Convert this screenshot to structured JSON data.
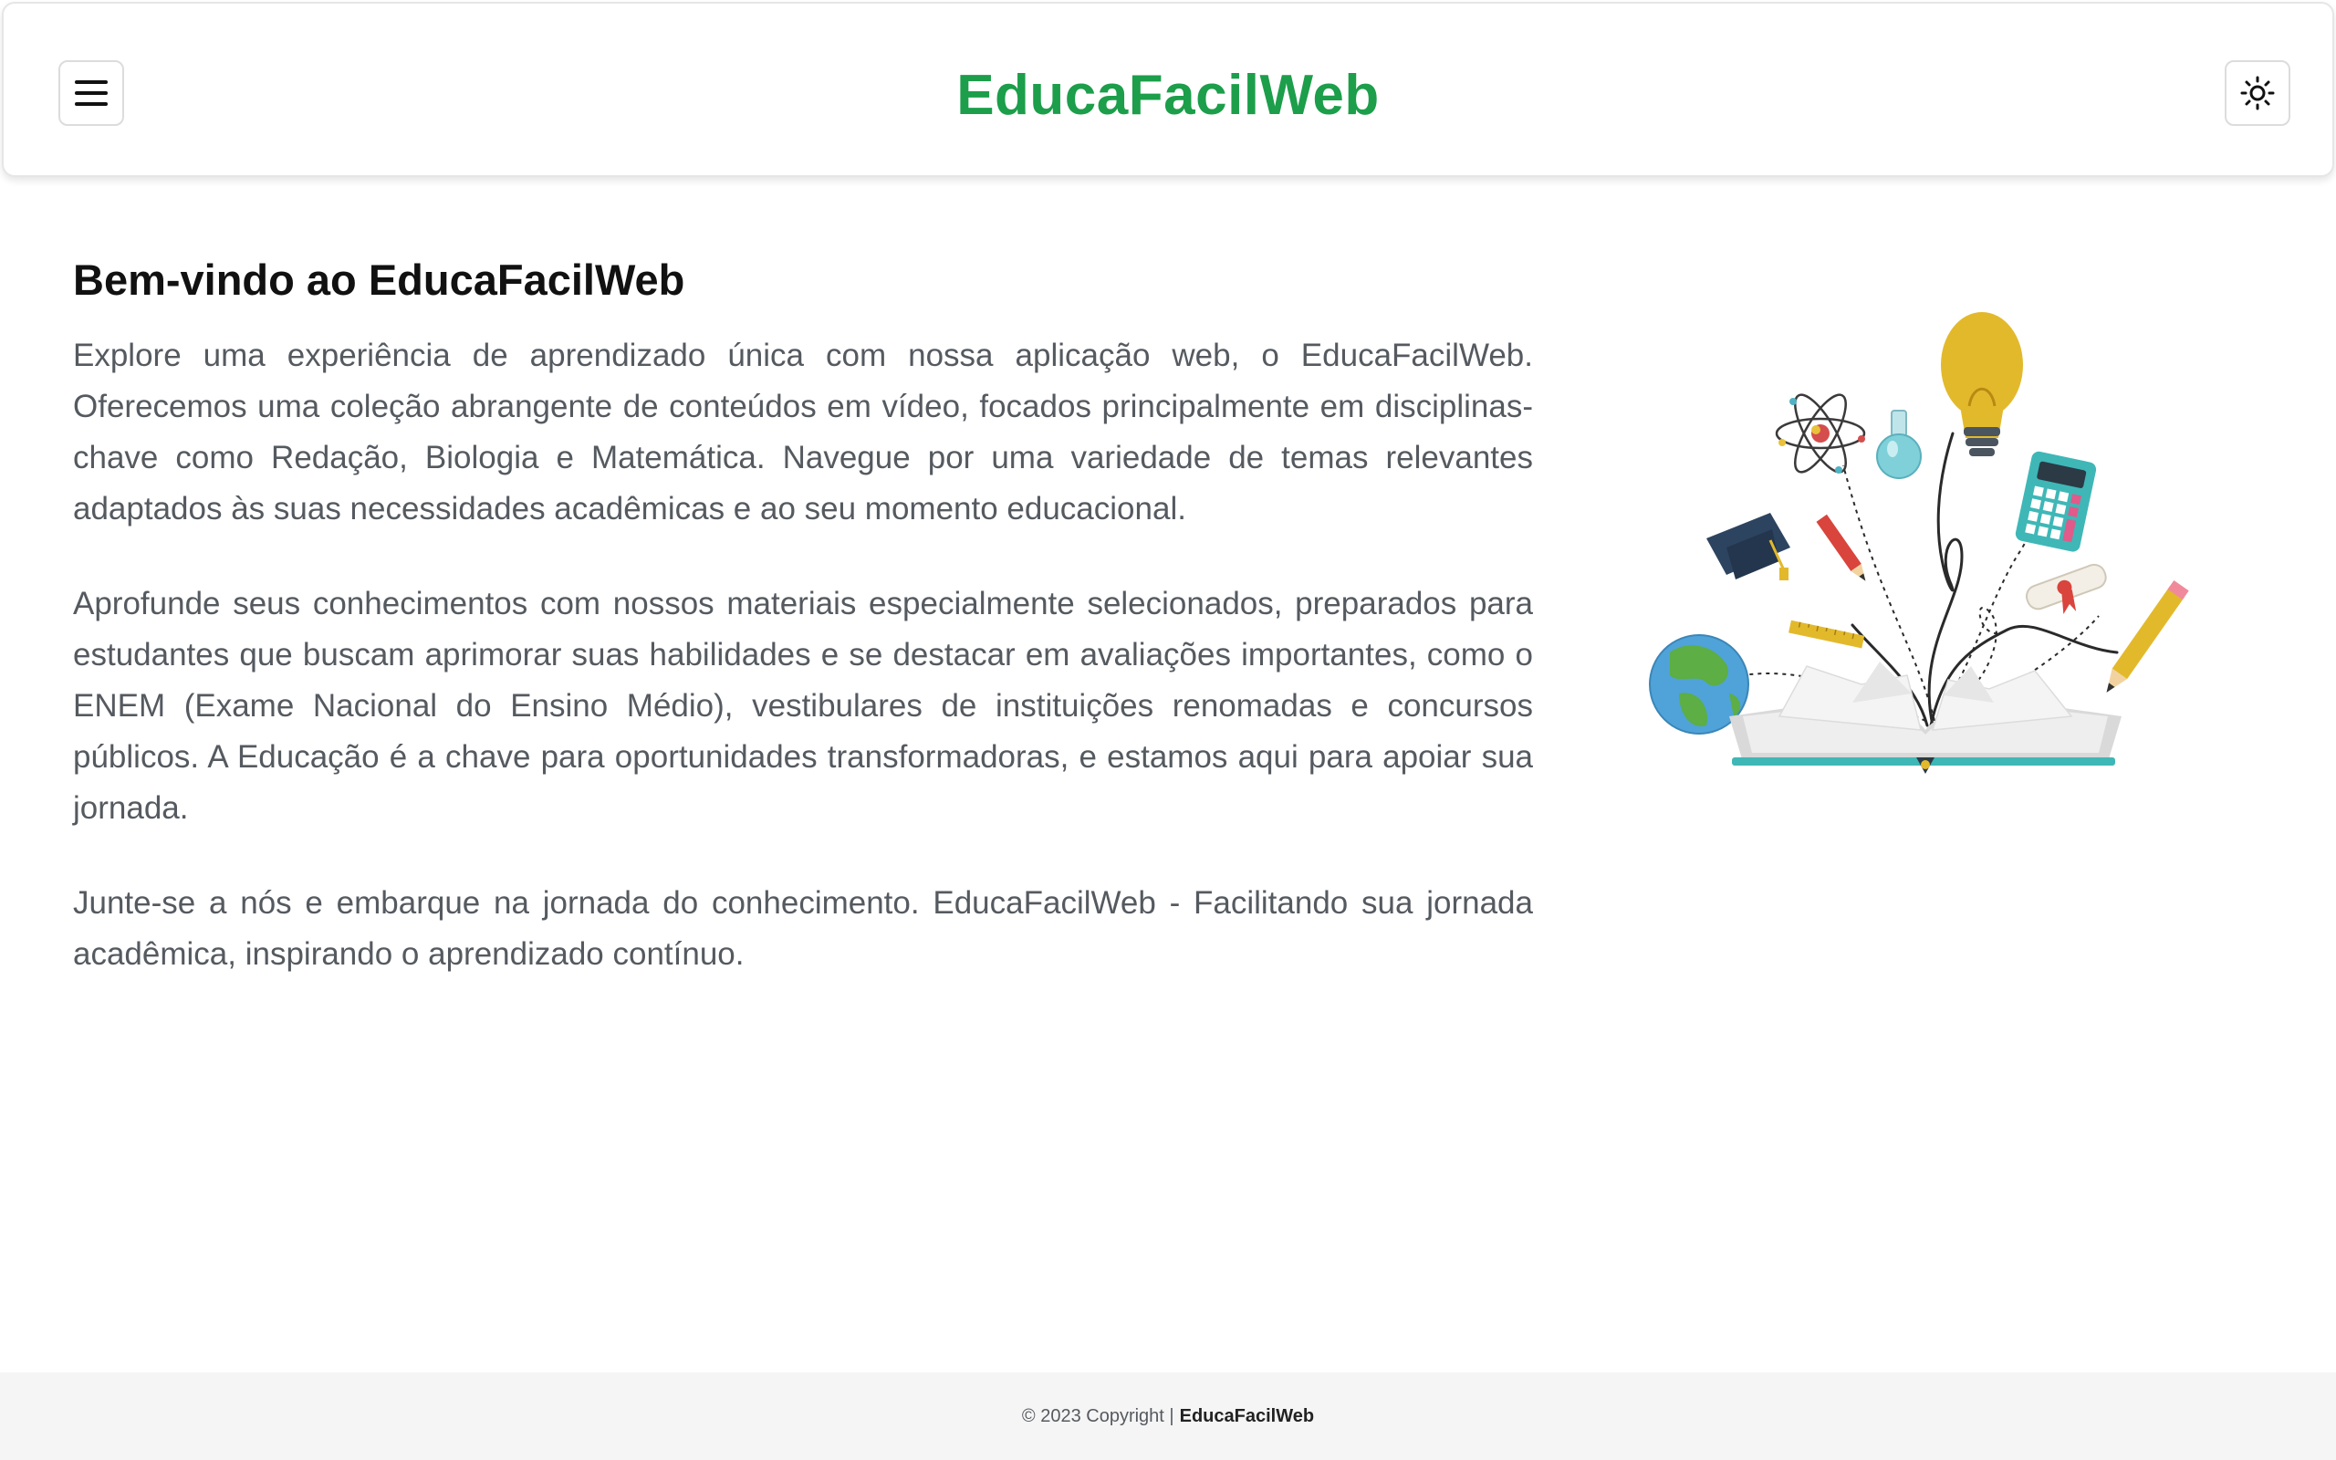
{
  "header": {
    "brand": "EducaFacilWeb",
    "menu_icon": "hamburger-menu-icon",
    "theme_icon": "sun-icon"
  },
  "main": {
    "title": "Bem-vindo ao EducaFacilWeb",
    "paragraphs": [
      "Explore uma experiência de aprendizado única com nossa aplicação web, o EducaFacilWeb. Oferecemos uma coleção abrangente de conteúdos em vídeo, focados principalmente em disciplinas-chave como Redação, Biologia e Matemática. Navegue por uma variedade de temas relevantes adaptados às suas necessidades acadêmicas e ao seu momento educacional.",
      "Aprofunde seus conhecimentos com nossos materiais especialmente selecionados, preparados para estudantes que buscam aprimorar suas habilidades e se destacar em avaliações importantes, como o ENEM (Exame Nacional do Ensino Médio), vestibulares de instituições renomadas e concursos públicos. A Educação é a chave para oportunidades transformadoras, e estamos aqui para apoiar sua jornada.",
      "Junte-se a nós e embarque na jornada do conhecimento. EducaFacilWeb - Facilitando sua jornada acadêmica, inspirando o aprendizado contínuo."
    ]
  },
  "illustration": {
    "icons": [
      "lightbulb-icon",
      "atom-icon",
      "flask-icon",
      "calculator-icon",
      "graduation-cap-icon",
      "pencil-icon",
      "diploma-icon",
      "globe-icon",
      "ruler-icon",
      "open-book-icon"
    ]
  },
  "footer": {
    "copyright": "© 2023 Copyright |",
    "brand": "EducaFacilWeb"
  },
  "colors": {
    "brand_green": "#1c9e4a",
    "text_gray": "#555a60",
    "footer_bg": "#f5f5f5"
  }
}
